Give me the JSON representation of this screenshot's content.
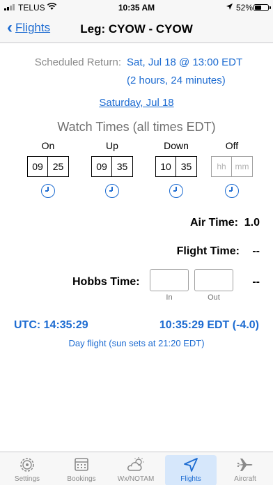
{
  "status_bar": {
    "carrier": "TELUS",
    "time": "10:35 AM",
    "battery": "52%",
    "battery_level": 0.52
  },
  "nav": {
    "back_label": "Flights",
    "title": "Leg: CYOW - CYOW"
  },
  "scheduled": {
    "label": "Scheduled Return:",
    "date": "Sat, Jul 18 @ 13:00 EDT",
    "duration": "(2 hours, 24 minutes)"
  },
  "date_link": "Saturday, Jul 18",
  "watch": {
    "title": "Watch Times (all times EDT)",
    "columns": [
      {
        "label": "On",
        "hh": "09",
        "mm": "25"
      },
      {
        "label": "Up",
        "hh": "09",
        "mm": "35"
      },
      {
        "label": "Down",
        "hh": "10",
        "mm": "35"
      },
      {
        "label": "Off",
        "hh": "",
        "mm": "",
        "hh_placeholder": "hh",
        "mm_placeholder": "mm"
      }
    ]
  },
  "air_time": {
    "label": "Air Time:",
    "value": "1.0"
  },
  "flight_time": {
    "label": "Flight Time:",
    "value": "--"
  },
  "hobbs": {
    "label": "Hobbs Time:",
    "in_label": "In",
    "out_label": "Out",
    "in_value": "",
    "out_value": "",
    "value": "--"
  },
  "clock": {
    "utc": "UTC: 14:35:29",
    "local": "10:35:29 EDT (-4.0)",
    "daylight": "Day flight (sun sets at 21:20 EDT)"
  },
  "tabs": [
    {
      "label": "Settings",
      "icon": "gear-icon"
    },
    {
      "label": "Bookings",
      "icon": "calendar-icon"
    },
    {
      "label": "Wx/NOTAM",
      "icon": "weather-icon"
    },
    {
      "label": "Flights",
      "icon": "paper-plane-icon",
      "active": true
    },
    {
      "label": "Aircraft",
      "icon": "airplane-icon"
    }
  ],
  "colors": {
    "accent": "#1c6bd1",
    "muted": "#8a8a8a",
    "tab_active_bg": "#d6e7fb"
  }
}
